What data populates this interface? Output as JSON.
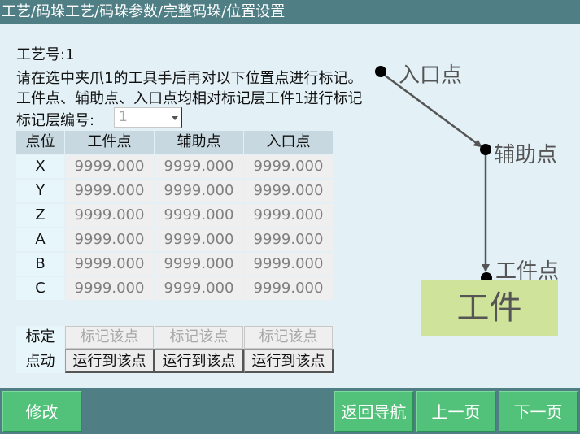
{
  "title": "工艺/码垛工艺/码垛参数/完整码垛/位置设置",
  "process_no_label": "工艺号:1",
  "instruction_line1": "请在选中夹爪1的工具手后再对以下位置点进行标记。",
  "instruction_line2": "工件点、辅助点、入口点均相对标记层工件1进行标记",
  "layer_label": "标记层编号:",
  "layer_value": "1",
  "table": {
    "headers": [
      "点位",
      "工件点",
      "辅助点",
      "入口点"
    ],
    "rows": [
      {
        "axis": "X",
        "values": [
          "9999.000",
          "9999.000",
          "9999.000"
        ]
      },
      {
        "axis": "Y",
        "values": [
          "9999.000",
          "9999.000",
          "9999.000"
        ]
      },
      {
        "axis": "Z",
        "values": [
          "9999.000",
          "9999.000",
          "9999.000"
        ]
      },
      {
        "axis": "A",
        "values": [
          "9999.000",
          "9999.000",
          "9999.000"
        ]
      },
      {
        "axis": "B",
        "values": [
          "9999.000",
          "9999.000",
          "9999.000"
        ]
      },
      {
        "axis": "C",
        "values": [
          "9999.000",
          "9999.000",
          "9999.000"
        ]
      }
    ]
  },
  "calibrate": {
    "label": "标定",
    "buttons": [
      "标记该点",
      "标记该点",
      "标记该点"
    ]
  },
  "jog": {
    "label": "点动",
    "buttons": [
      "运行到该点",
      "运行到该点",
      "运行到该点"
    ]
  },
  "diagram": {
    "entry_label": "入口点",
    "aux_label": "辅助点",
    "work_label": "工件点",
    "workpiece_text": "工件"
  },
  "footer": {
    "modify": "修改",
    "back_nav": "返回导航",
    "prev": "上一页",
    "next": "下一页"
  },
  "colors": {
    "title_bar": "#4f7e84",
    "background": "#e3f1f7",
    "button_green": "#52c17a",
    "workpiece": "#cfe49a"
  }
}
